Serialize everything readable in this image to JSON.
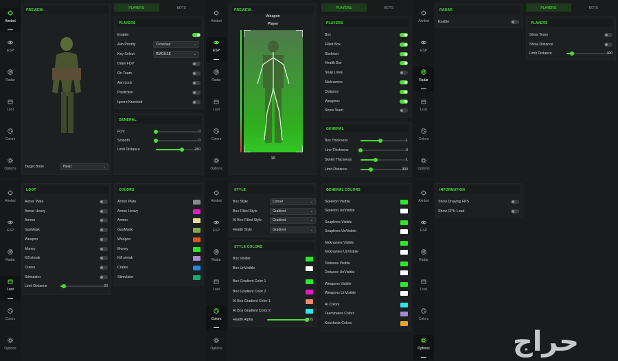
{
  "nav": [
    {
      "key": "aimbot",
      "label": "Aimbot",
      "icon": "crosshair-icon"
    },
    {
      "key": "esp",
      "label": "ESP",
      "icon": "eye-icon"
    },
    {
      "key": "radar",
      "label": "Radar",
      "icon": "radar-icon"
    },
    {
      "key": "loot",
      "label": "Loot",
      "icon": "box-icon"
    },
    {
      "key": "colors",
      "label": "Colors",
      "icon": "palette-icon"
    },
    {
      "key": "options",
      "label": "Options",
      "icon": "gear-icon"
    }
  ],
  "common": {
    "preview": "PREVIEW",
    "players_tab": "PLAYERS",
    "bots_tab": "BOTS",
    "players_header": "PLAYERS",
    "general_header": "GENERAL"
  },
  "aimbot": {
    "toggles": [
      {
        "label": "Enable",
        "on": true
      },
      {
        "label": "Draw FOV",
        "on": false
      },
      {
        "label": "On Team",
        "on": false
      },
      {
        "label": "Aim Lock",
        "on": false
      },
      {
        "label": "Prediction",
        "on": false
      },
      {
        "label": "Ignore Knocked",
        "on": false
      }
    ],
    "aim_priority_label": "Aim Priority",
    "aim_priority_value": "Crosshair",
    "key_select_label": "Key Select",
    "key_select_value": "RMOUSE",
    "sliders": [
      {
        "label": "FOV",
        "value": "0",
        "fraction": 0.0
      },
      {
        "label": "Smooth",
        "value": "0",
        "fraction": 0.0
      },
      {
        "label": "Limit Distance",
        "value": "250",
        "fraction": 0.62
      }
    ],
    "target_bone_label": "Target Bone",
    "target_bone_value": "Head"
  },
  "esp": {
    "weapon_label": "Weapon",
    "player_label": "Player",
    "distance_value": "10",
    "toggles": [
      {
        "label": "Box",
        "on": true
      },
      {
        "label": "Filled Box",
        "on": true
      },
      {
        "label": "Skeleton",
        "on": true
      },
      {
        "label": "Health Bar",
        "on": true
      },
      {
        "label": "Snap Lines",
        "on": false
      },
      {
        "label": "Nicknames",
        "on": true
      },
      {
        "label": "Distance",
        "on": true
      },
      {
        "label": "Weapons",
        "on": true
      },
      {
        "label": "Show Team",
        "on": false
      }
    ],
    "sliders": [
      {
        "label": "Box Thickness",
        "value": "1",
        "fraction": 0.42
      },
      {
        "label": "Line Thickness",
        "value": "0",
        "fraction": 0.0
      },
      {
        "label": "Skelet Thickness",
        "value": "1",
        "fraction": 0.32
      },
      {
        "label": "Limit Distance",
        "value": "300",
        "fraction": 0.22
      }
    ]
  },
  "radar": {
    "header": "RADAR",
    "enable_label": "Enable",
    "toggles": [
      {
        "label": "Show Team",
        "on": false
      },
      {
        "label": "Show Distance",
        "on": false
      }
    ],
    "limit_label": "Limit Distance",
    "limit_value": "300",
    "limit_fraction": 0.12
  },
  "loot": {
    "header": "LOOT",
    "items": [
      {
        "label": "Armor Plate",
        "on": false
      },
      {
        "label": "Armor Heavy",
        "on": false
      },
      {
        "label": "Ammo",
        "on": false
      },
      {
        "label": "GasMask",
        "on": false
      },
      {
        "label": "Weapon",
        "on": false
      },
      {
        "label": "Money",
        "on": false
      },
      {
        "label": "Kill streak",
        "on": false
      },
      {
        "label": "Crates",
        "on": false
      },
      {
        "label": "Stimulator",
        "on": false
      }
    ],
    "limit_label": "Limit Distance",
    "limit_value": "20",
    "limit_fraction": 0.08
  },
  "loot_colors": {
    "header": "COLORS",
    "items": [
      {
        "label": "Armor Plate",
        "color": "#8a8a8a"
      },
      {
        "label": "Armor Heavy",
        "color": "#e01cc8"
      },
      {
        "label": "Ammo",
        "color": "#e9dd93"
      },
      {
        "label": "GasMask",
        "color": "#8aaa4a"
      },
      {
        "label": "Weapon",
        "color": "#e2561c"
      },
      {
        "label": "Money",
        "color": "#2ee62a"
      },
      {
        "label": "Kill streak",
        "color": "#a58bd6"
      },
      {
        "label": "Crates",
        "color": "#1e8ae6"
      },
      {
        "label": "Stimulator",
        "color": "#1ba870"
      }
    ]
  },
  "style": {
    "header": "STYLE",
    "rows": [
      {
        "label": "Box Style",
        "value": "Corner"
      },
      {
        "label": "Box Filled Style",
        "value": "Gradient"
      },
      {
        "label": "AI Box Filled Style",
        "value": "Gradient"
      },
      {
        "label": "Health Style",
        "value": "Gradient"
      }
    ]
  },
  "style_colors": {
    "header": "STYLE COLORS",
    "items": [
      {
        "label": "Box Visible",
        "color": "#2ee62a"
      },
      {
        "label": "Box UnVisible",
        "color": "#ffffff"
      },
      {
        "label": "Box Gradient Color 1",
        "color": "#2ee62a"
      },
      {
        "label": "Box Gradient Color 2",
        "color": "#e01cc8"
      },
      {
        "label": "AI Box Gradient Color 1",
        "color": "#e98a6b"
      },
      {
        "label": "AI Box Gradient Color 2",
        "color": "#2ee6e6"
      }
    ],
    "health_label": "Health Alpha",
    "health_value": "255",
    "health_fraction": 1.0
  },
  "general_colors": {
    "header": "GENERAL COLORS",
    "items": [
      {
        "label": "Skeleton Visible",
        "color": "#2ee62a"
      },
      {
        "label": "Skeleton UnVisible",
        "color": "#ffffff"
      },
      {
        "label": "Snaplines Visible",
        "color": "#2ee62a"
      },
      {
        "label": "Snaplines UnVisible",
        "color": "#ffffff"
      },
      {
        "label": "Nicknames Visible",
        "color": "#2ee62a"
      },
      {
        "label": "Nicknames UnVisible",
        "color": "#ffffff"
      },
      {
        "label": "Distance Visible",
        "color": "#2ee62a"
      },
      {
        "label": "Distance UnVisible",
        "color": "#ffffff"
      },
      {
        "label": "Weapons Visible",
        "color": "#2ee62a"
      },
      {
        "label": "Weapons UnVisible",
        "color": "#ffffff"
      },
      {
        "label": "AI Colors",
        "color": "#2ee6e6"
      },
      {
        "label": "Teammates Colors",
        "color": "#a58bd6"
      },
      {
        "label": "Knockeds Colors",
        "color": "#e9a52a"
      }
    ]
  },
  "information": {
    "header": "INFORMATION",
    "toggles": [
      {
        "label": "Show Drawing FPS",
        "on": false
      },
      {
        "label": "Show CPU Load",
        "on": false
      }
    ]
  },
  "watermark": "حراج"
}
